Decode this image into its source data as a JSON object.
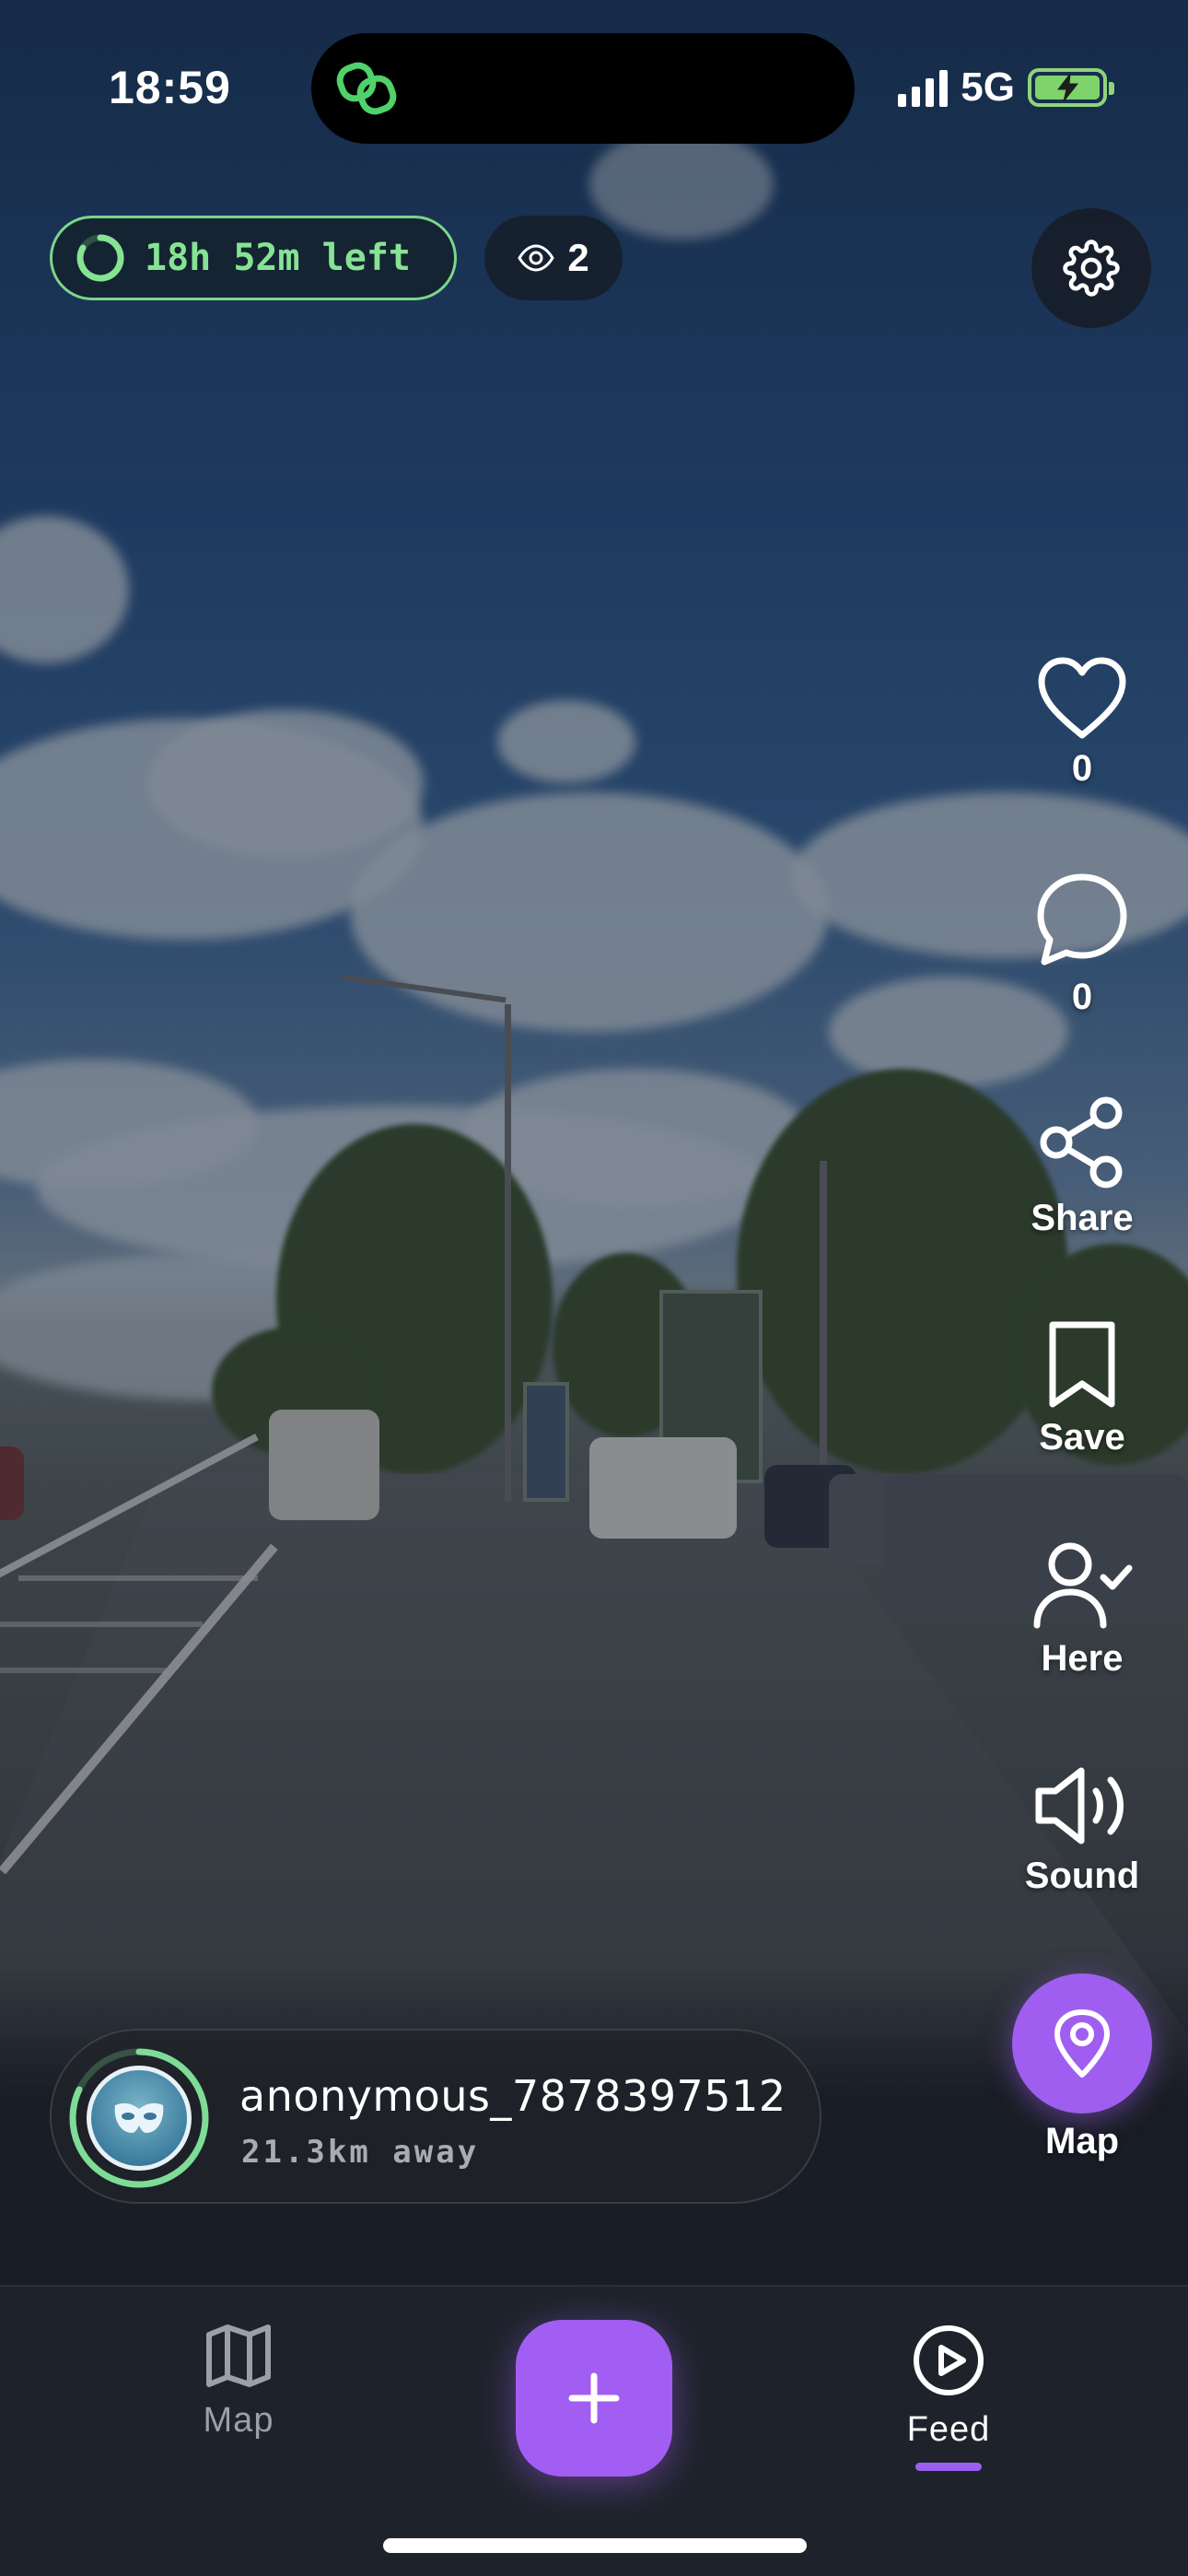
{
  "status_bar": {
    "time": "18:59",
    "network": "5G",
    "icons": [
      "app-link-icon",
      "signal-icon",
      "battery-charging-icon"
    ]
  },
  "post": {
    "time_left": "18h 52m left",
    "views": "2"
  },
  "actions": {
    "like_count": "0",
    "comment_count": "0",
    "share_label": "Share",
    "save_label": "Save",
    "here_label": "Here",
    "sound_label": "Sound",
    "map_label": "Map"
  },
  "author": {
    "username": "anonymous_7878397512",
    "distance": "21.3km away"
  },
  "tabbar": {
    "map_label": "Map",
    "feed_label": "Feed",
    "active": "Feed"
  },
  "colors": {
    "accent": "#a25df2",
    "timer_green": "#7bd68b",
    "tab_inactive": "#9aa0a8"
  }
}
